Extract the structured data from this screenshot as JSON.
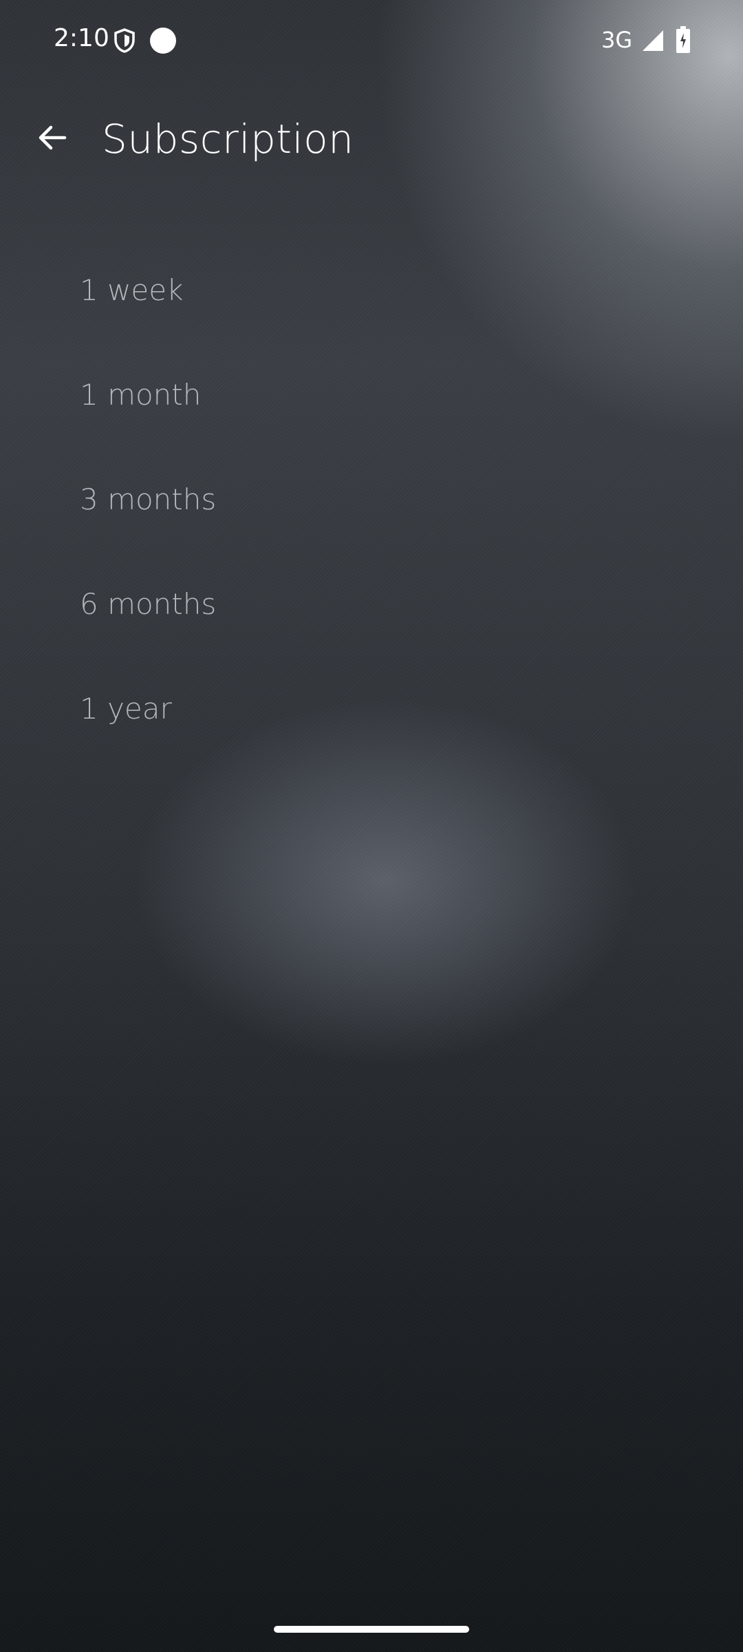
{
  "status_bar": {
    "time": "2:10",
    "network": "3G",
    "icons": [
      "shield-icon",
      "dot-icon",
      "signal-icon",
      "battery-icon"
    ]
  },
  "app_bar": {
    "title": "Subscription",
    "back_icon": "arrow-back-icon"
  },
  "options": [
    {
      "label": "1 week"
    },
    {
      "label": "1 month"
    },
    {
      "label": "3 months"
    },
    {
      "label": "6 months"
    },
    {
      "label": "1 year"
    }
  ],
  "colors": {
    "text_primary": "#ffffff",
    "text_option": "#c9cdd2",
    "background_dark": "#16191c"
  }
}
